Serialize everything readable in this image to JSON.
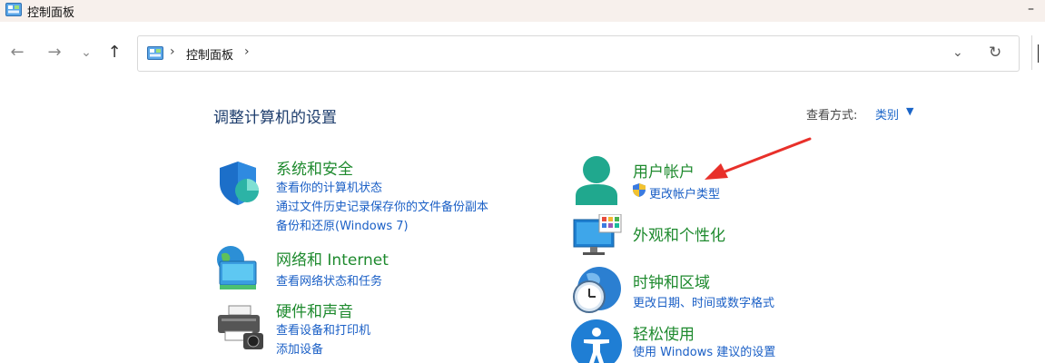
{
  "window": {
    "title": "控制面板",
    "minimize": "–"
  },
  "nav": {
    "back": "←",
    "forward": "→",
    "recent": "⌄",
    "up": "↑"
  },
  "address": {
    "sep1": "›",
    "crumb": "控制面板",
    "sep2": "›",
    "dropdown": "⌄",
    "refresh": "↻"
  },
  "heading": "调整计算机的设置",
  "view": {
    "label": "查看方式:",
    "value": "类别",
    "arrow": "▼"
  },
  "categories": [
    {
      "title": "系统和安全",
      "icon": "shield-icon",
      "links": [
        "查看你的计算机状态",
        "通过文件历史记录保存你的文件备份副本",
        "备份和还原(Windows 7)"
      ]
    },
    {
      "title": "网络和 Internet",
      "icon": "network-globe-icon",
      "links": [
        "查看网络状态和任务"
      ]
    },
    {
      "title": "硬件和声音",
      "icon": "printer-icon",
      "links": [
        "查看设备和打印机",
        "添加设备"
      ]
    },
    {
      "title": "用户帐户",
      "icon": "user-icon",
      "links": [
        "更改帐户类型"
      ]
    },
    {
      "title": "外观和个性化",
      "icon": "monitor-icon",
      "links": []
    },
    {
      "title": "时钟和区域",
      "icon": "clock-globe-icon",
      "links": [
        "更改日期、时间或数字格式"
      ]
    },
    {
      "title": "轻松使用",
      "icon": "accessibility-icon",
      "links": [
        "使用 Windows 建议的设置"
      ]
    }
  ],
  "colors": {
    "accent_link": "#1a5fc6",
    "category_title": "#1e8a2e",
    "heading": "#1c3c6c",
    "arrow": "#e8302a"
  }
}
